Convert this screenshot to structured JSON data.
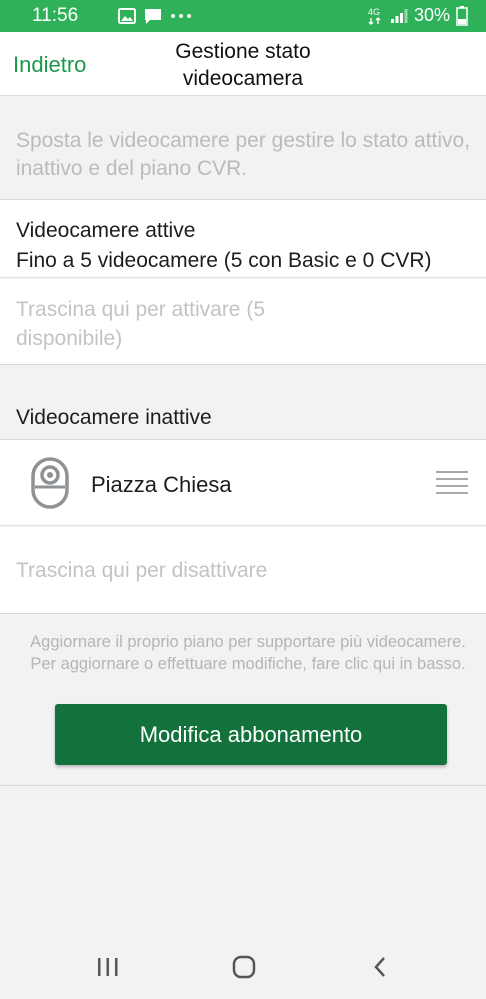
{
  "status_bar": {
    "time": "11:56",
    "network": "4G",
    "battery": "30%"
  },
  "header": {
    "back_label": "Indietro",
    "title": "Gestione stato videocamera"
  },
  "instructions": "Sposta le videocamere per gestire lo stato attivo, inattivo e del piano CVR.",
  "active_section": {
    "title": "Videocamere attive",
    "subtitle": "Fino a 5 videocamere (5 con Basic e 0 CVR)",
    "drop_hint": "Trascina qui per attivare (5 disponibile)"
  },
  "inactive_section": {
    "title": "Videocamere inattive",
    "cameras": [
      {
        "name": "Piazza Chiesa"
      }
    ],
    "drop_hint": "Trascina qui per disattivare"
  },
  "upgrade": {
    "note": "Aggiornare il proprio piano per supportare più videocamere. Per aggiornare o effettuare modifiche, fare clic qui in basso.",
    "button_label": "Modifica abbonamento"
  },
  "colors": {
    "status_bar": "#2fb15a",
    "accent": "#1a9a4a",
    "button": "#13713c"
  },
  "icons": {
    "gallery": "image-icon",
    "message": "message-icon",
    "more": "more-dots-icon",
    "signal": "signal-icon",
    "battery": "battery-icon",
    "camera": "camera-icon",
    "drag": "drag-handle-icon",
    "recents": "recents-icon",
    "home": "home-icon",
    "back": "back-icon"
  }
}
